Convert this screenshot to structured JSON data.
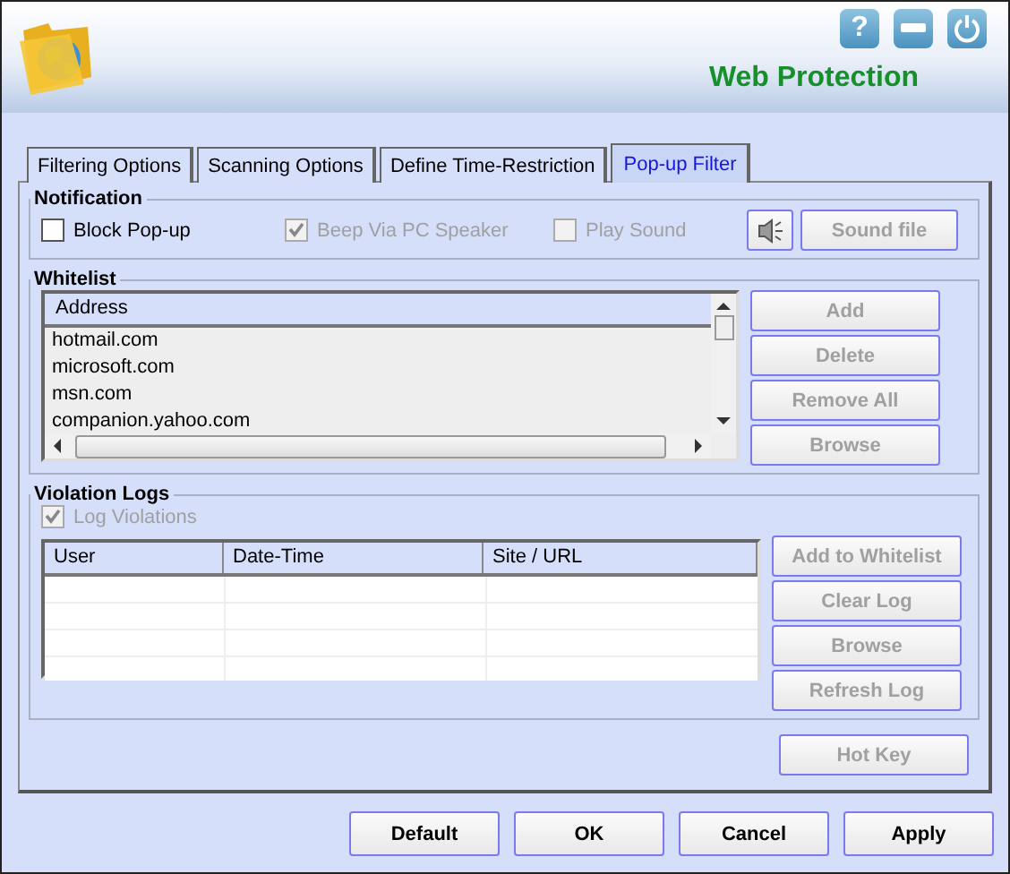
{
  "header": {
    "title": "Web Protection",
    "controls": [
      "?"
    ]
  },
  "tabs": [
    {
      "label": "Filtering Options",
      "selected": false
    },
    {
      "label": "Scanning Options",
      "selected": false
    },
    {
      "label": "Define Time-Restriction",
      "selected": false
    },
    {
      "label": "Pop-up Filter",
      "selected": true
    }
  ],
  "notification": {
    "title": "Notification",
    "options": [
      {
        "label": "Block Pop-up",
        "checked": false,
        "disabled": false
      },
      {
        "label": "Beep Via PC Speaker",
        "checked": true,
        "disabled": true
      },
      {
        "label": "Play Sound",
        "checked": false,
        "disabled": true
      }
    ],
    "sound_button": {
      "label": "Sound file",
      "disabled": true
    }
  },
  "whitelist": {
    "title": "Whitelist",
    "column": "Address",
    "rows": [
      "hotmail.com",
      "microsoft.com",
      "msn.com",
      "companion.yahoo.com"
    ],
    "buttons": [
      {
        "label": "Add",
        "disabled": true
      },
      {
        "label": "Delete",
        "disabled": true
      },
      {
        "label": "Remove All",
        "disabled": true
      },
      {
        "label": "Browse",
        "disabled": true
      }
    ]
  },
  "violation_logs": {
    "title": "Violation Logs",
    "log_option": {
      "label": "Log Violations",
      "checked": true,
      "disabled": true
    },
    "columns": [
      "User",
      "Date-Time",
      "Site / URL"
    ],
    "buttons": [
      {
        "label": "Add to Whitelist",
        "disabled": true
      },
      {
        "label": "Clear Log",
        "disabled": true
      },
      {
        "label": "Browse",
        "disabled": true
      },
      {
        "label": "Refresh Log",
        "disabled": true
      }
    ]
  },
  "hot_key": {
    "label": "Hot Key",
    "disabled": true
  },
  "footer_buttons": [
    {
      "label": "Default",
      "disabled": false
    },
    {
      "label": "OK",
      "disabled": false
    },
    {
      "label": "Cancel",
      "disabled": false
    },
    {
      "label": "Apply",
      "disabled": false
    }
  ]
}
